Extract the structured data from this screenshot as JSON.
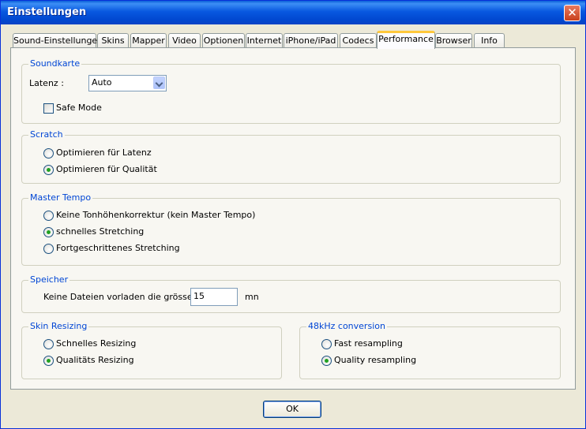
{
  "window": {
    "title": "Einstellungen",
    "close_glyph": "✕"
  },
  "tabs": [
    {
      "label": "Sound-Einstellungen"
    },
    {
      "label": "Skins"
    },
    {
      "label": "Mapper"
    },
    {
      "label": "Video"
    },
    {
      "label": "Optionen"
    },
    {
      "label": "Internet"
    },
    {
      "label": "iPhone/iPad"
    },
    {
      "label": "Codecs"
    },
    {
      "label": "Performance",
      "active": true
    },
    {
      "label": "Browser"
    },
    {
      "label": "Info"
    }
  ],
  "soundkarte": {
    "title": "Soundkarte",
    "latenz_label": "Latenz :",
    "latenz_value": "Auto",
    "safe_mode_label": "Safe Mode",
    "safe_mode_checked": false
  },
  "scratch": {
    "title": "Scratch",
    "options": [
      {
        "label": "Optimieren für Latenz",
        "checked": false
      },
      {
        "label": "Optimieren für Qualität",
        "checked": true
      }
    ]
  },
  "master_tempo": {
    "title": "Master Tempo",
    "options": [
      {
        "label": "Keine Tonhöhenkorrektur (kein Master Tempo)",
        "checked": false
      },
      {
        "label": "schnelles Stretching",
        "checked": true
      },
      {
        "label": "Fortgeschrittenes Stretching",
        "checked": false
      }
    ]
  },
  "speicher": {
    "title": "Speicher",
    "label": "Keine Dateien vorladen die grösser",
    "value": "15",
    "unit": "mn"
  },
  "skin_resizing": {
    "title": "Skin Resizing",
    "options": [
      {
        "label": "Schnelles Resizing",
        "checked": false
      },
      {
        "label": "Qualitäts Resizing",
        "checked": true
      }
    ]
  },
  "conversion": {
    "title": "48kHz conversion",
    "options": [
      {
        "label": "Fast resampling",
        "checked": false
      },
      {
        "label": "Quality resampling",
        "checked": true
      }
    ]
  },
  "ok_label": "OK",
  "colors": {
    "title_bar": "#0058e6",
    "group_label": "#0046d5",
    "active_tab_accent": "#ffc83c",
    "radio_dot": "#21a121"
  }
}
